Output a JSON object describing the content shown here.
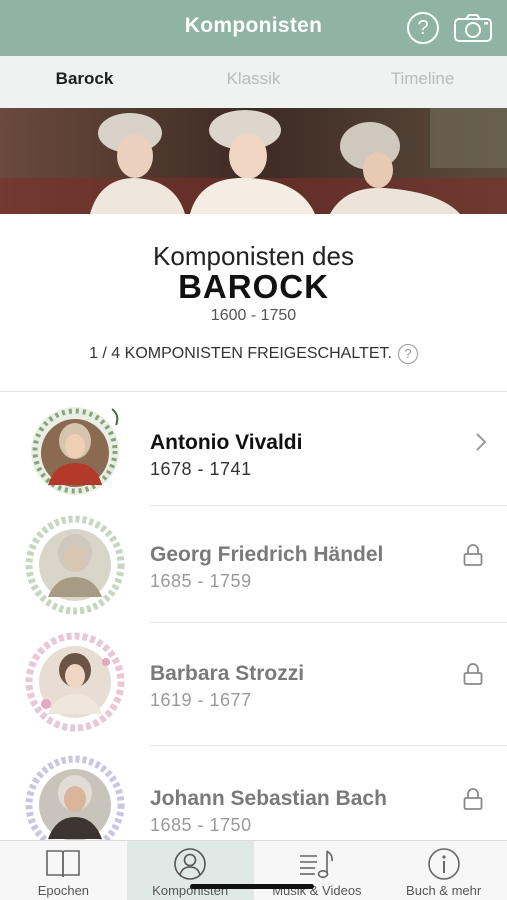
{
  "header": {
    "title": "Komponisten",
    "help_label": "?",
    "camera_icon": "camera-icon",
    "bg": "#8fb3a5"
  },
  "tabs": [
    {
      "label": "Barock",
      "active": true
    },
    {
      "label": "Klassik",
      "active": false
    },
    {
      "label": "Timeline",
      "active": false
    }
  ],
  "banner": {
    "icon": "baroque-painting-image"
  },
  "intro": {
    "line1": "Komponisten des",
    "epoch": "BAROCK",
    "period": "1600 - 1750",
    "unlock_text": "1 / 4 KOMPONISTEN FREIGESCHALTET.",
    "help": "?"
  },
  "composers": [
    {
      "name": "Antonio Vivaldi",
      "years": "1678 - 1741",
      "locked": false,
      "icon": "chevron-right-icon"
    },
    {
      "name": "Georg Friedrich Händel",
      "years": "1685 - 1759",
      "locked": true,
      "icon": "lock-icon"
    },
    {
      "name": "Barbara Strozzi",
      "years": "1619 - 1677",
      "locked": true,
      "icon": "lock-icon"
    },
    {
      "name": "Johann Sebastian Bach",
      "years": "1685 - 1750",
      "locked": true,
      "icon": "lock-icon"
    }
  ],
  "tabbar": [
    {
      "label": "Epochen",
      "icon": "book-icon",
      "active": false
    },
    {
      "label": "Komponisten",
      "icon": "person-icon",
      "active": true
    },
    {
      "label": "Musik & Videos",
      "icon": "music-list-icon",
      "active": false
    },
    {
      "label": "Buch & mehr",
      "icon": "info-icon",
      "active": false
    }
  ]
}
